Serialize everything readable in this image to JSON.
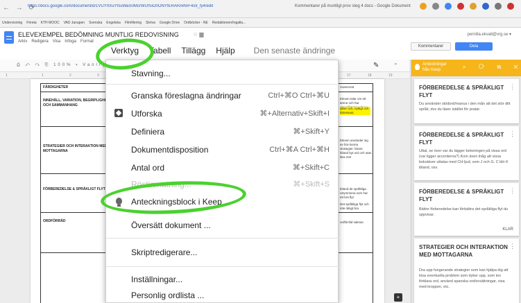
{
  "browser": {
    "nav_icons": "← → ⟳",
    "url": "https://docs.google.com/document/d/1VUYrtXuYfsuWaS0McrWUfSiO0ONYfERARAlhnF4s9_fy4/edit",
    "tab_title": "Kommentarer på muntligt prov steg 4 docs - Google Dokument",
    "bookmarks": [
      "Undervisning",
      "Företa",
      "KTH MOOC",
      "VAD Janapen",
      "Svenska",
      "Engelska",
      "Filmfilering",
      "Skriva",
      "Google Drive",
      "Ordböcker - NE",
      "Redaktionen/Ingalla..."
    ],
    "icon_colors": [
      "#f0a020",
      "#888888",
      "#4285f4",
      "#cc3333",
      "#e0a030",
      "#3366cc",
      "#777777",
      "#cc3333"
    ]
  },
  "docs": {
    "title": "ELEVEXEMPEL BEDÖMNING MUNTLIG REDOVISNING",
    "star_folder": "☆ ▆",
    "menu_small": [
      "Arkiv",
      "Redigera",
      "Visa",
      "Infoga",
      "Format"
    ],
    "user_email": "pernilla.ekvall@vrg.se ▾",
    "comments_label": "Kommentarer",
    "share_label": "Dela",
    "menubar": {
      "verktyg": "Verktyg",
      "tabell": "Tabell",
      "tillagg": "Tillägg",
      "hjalp": "Hjälp",
      "last_edit": "Den senaste ändringe"
    },
    "toolbar": {
      "tools": "⎙ ↶ ↷ ⎘ 100% ▾ Vanlig",
      "pen": "✎",
      "collapse": "⌃"
    },
    "ruler_ticks": [
      "1",
      "1",
      "2",
      "3",
      "4",
      "5",
      "15",
      "16",
      "17",
      "18",
      "19"
    ],
    "insert": "+"
  },
  "table": {
    "rows": [
      "FÄRDIGHETER",
      "INNEHÅLL, VARIATION, BEGRIPLIGHET OCH SAMMANHANG",
      "STRATEGIER OCH INTERAKTION MED MOTTAGARNA",
      "FÖRBEREDELSE & SPRÅKLIGT FLYT",
      "ORDFÖRRÅD"
    ],
    "snippets": [
      "Avancerat",
      "Eleven talar om ett ämne och har utvecklat sina ideer",
      "idéer och, nyttigt och intressant.",
      "Eleven använder sig av bra kunna strategier: lärare ibland byt ord och utan lära mer",
      "Ibland de språkliga utrymmena som har ett bra flyt",
      "Det språkliga flyt och inte riktigt bra",
      "ordförråd saknas"
    ]
  },
  "dropdown": {
    "items": [
      {
        "label": "Stavning...",
        "shortcut": ""
      },
      {
        "label": "Granska föreslagna ändringar",
        "shortcut": "Ctrl+⌘O Ctrl+⌘U"
      },
      {
        "label": "Utforska",
        "shortcut": "⌘+Alternativ+Skift+I"
      },
      {
        "label": "Definiera",
        "shortcut": "⌘+Skift+Y"
      },
      {
        "label": "Dokumentdisposition",
        "shortcut": "Ctrl+⌘A Ctrl+⌘H"
      },
      {
        "label": "Antal ord",
        "shortcut": "⌘+Skift+C"
      },
      {
        "label": "Röstinmatning...",
        "shortcut": "⌘+Skift+S"
      },
      {
        "label": "Anteckningsblock i Keep",
        "shortcut": ""
      },
      {
        "label": "Översätt dokument ...",
        "shortcut": ""
      },
      {
        "label": "Skriptredigerare...",
        "shortcut": ""
      },
      {
        "label": "Inställningar...",
        "shortcut": ""
      },
      {
        "label": "Personlig ordlista ...",
        "shortcut": ""
      }
    ]
  },
  "keep": {
    "header_title": "Anteckningar från Keep",
    "header_actions": "⌕ ⟳ ⧉ ✕",
    "notes": [
      {
        "title": "FÖRBEREDELSE & SPRÅKLIGT FLYT",
        "body": "Du använder stödord/manus i den mån att det stör ditt språk; dvs du läser istället för pratar."
      },
      {
        "title": "FÖRBEREDELSE & SPRÅKLIGT FLYT",
        "body": "Uttal, se över var du lägger betoningen på vissa ord (var ligger accenterna?) Kom även ihåg att vissa bokstäver uttalas med CH-ljud, som J och G. C blir K ibland, osv."
      },
      {
        "title": "FÖRBEREDELSE & SPRÅKLIGT FLYT",
        "body": "Bättre förberedelse kan förbättra det språkliga flyt du uppvisar.",
        "action": "KLAR"
      },
      {
        "title": "STRATEGIER OCH INTERAKTION MED MOTTAGARNA",
        "body": "Dra upp fungerande strategier som kan hjälpa dig att lösa eventuella problem som dyker upp, som tex förklara ord, använd spanska ord/ersättningar, visa med kroppen, etc."
      }
    ],
    "menu_icon": "⋮"
  }
}
